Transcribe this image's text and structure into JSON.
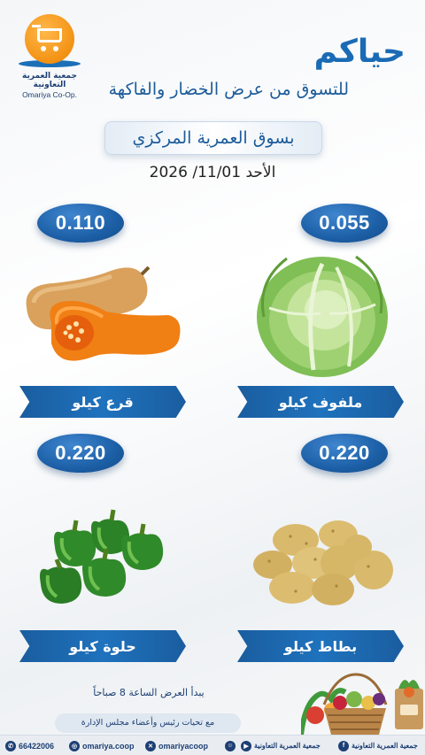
{
  "logo": {
    "name_ar": "جمعية العمرية التعاونية",
    "name_en": "Omariya Co-Op."
  },
  "header": {
    "headline": "حياكم",
    "subline": "للتسوق من عرض الخضار والفاكهة",
    "market": "بسوق العمرية المركزي",
    "date": "الأحد 11/01/ 2026"
  },
  "products": [
    {
      "price": "0.110",
      "label": "قرع كيلو",
      "icon": "butternut-squash-icon"
    },
    {
      "price": "0.055",
      "label": "ملفوف كيلو",
      "icon": "cabbage-icon"
    },
    {
      "price": "0.220",
      "label": "حلوة كيلو",
      "icon": "green-pepper-icon"
    },
    {
      "price": "0.220",
      "label": "بطاط كيلو",
      "icon": "potato-icon"
    }
  ],
  "footer": {
    "start_time": "يبدأ العرض الساعة 8 صباحاً",
    "greeting": "مع تحيات رئيس وأعضاء مجلس الإدارة",
    "phone": "66422006",
    "instagram": "omariya.coop",
    "x_handle": "omariyacoop",
    "snapchat": "omariyacoop",
    "youtube": "جمعية العمرية التعاونية",
    "facebook": "جمعية العمرية التعاونية"
  },
  "colors": {
    "primary_blue": "#1a6bb5",
    "navy": "#1d3f73",
    "logo_orange": "#f39214"
  }
}
